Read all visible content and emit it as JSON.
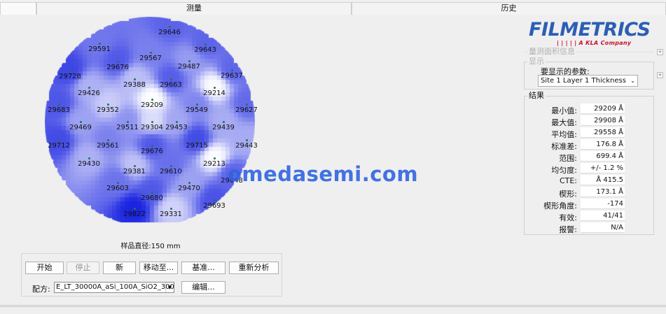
{
  "tabs": {
    "measure": "测量",
    "history": "历史"
  },
  "logo": {
    "name": "FILMETRICS",
    "tagline": "A KLA Company"
  },
  "groups": {
    "group1_title": "量测面积信息",
    "group2_title": "显示"
  },
  "display": {
    "param_label": "要显示的参数:",
    "param_value": "Site 1 Layer 1 Thickness"
  },
  "results": {
    "title": "结果",
    "rows": [
      {
        "label": "最小值:",
        "value": "29209 Å"
      },
      {
        "label": "最大值:",
        "value": "29908 Å"
      },
      {
        "label": "平均值:",
        "value": "29558 Å"
      },
      {
        "label": "标准差:",
        "value": "176.8 Å"
      },
      {
        "label": "范围:",
        "value": "699.4 Å"
      },
      {
        "label": "均匀度:",
        "value": "+/- 1.2 %"
      },
      {
        "label": "CTE:",
        "value": "Å 415.5"
      },
      {
        "label": "楔形:",
        "value": "173.1 Å"
      },
      {
        "label": "楔形角度:",
        "value": "-174"
      },
      {
        "label": "有效:",
        "value": "41/41"
      },
      {
        "label": "报警:",
        "value": "N/A"
      }
    ]
  },
  "wafer": {
    "sample_diameter": "样品直径:150 mm",
    "color_low": "#1a24e0",
    "color_high": "#ffffff",
    "site_count": 41,
    "sites": [
      29646,
      29591,
      29643,
      29567,
      29676,
      29487,
      29637,
      29728,
      29388,
      29663,
      29426,
      29214,
      29209,
      29683,
      29352,
      29549,
      29627,
      29469,
      29511,
      29304,
      29453,
      29439,
      29712,
      29561,
      29715,
      29443,
      29676,
      29430,
      29213,
      29381,
      29610,
      29648,
      29603,
      29470,
      29680,
      29693,
      29331,
      29822
    ]
  },
  "controls": {
    "start": "开始",
    "stop": "停止",
    "new": "新",
    "move_to": "移动至...",
    "baseline": "基准...",
    "reanalyze": "重新分析",
    "recipe_label": "配方:",
    "recipe_value": "E_LT_30000A_aSi_100A_SiO2_300",
    "edit": "编辑..."
  },
  "watermark": "omedasemi.com"
}
